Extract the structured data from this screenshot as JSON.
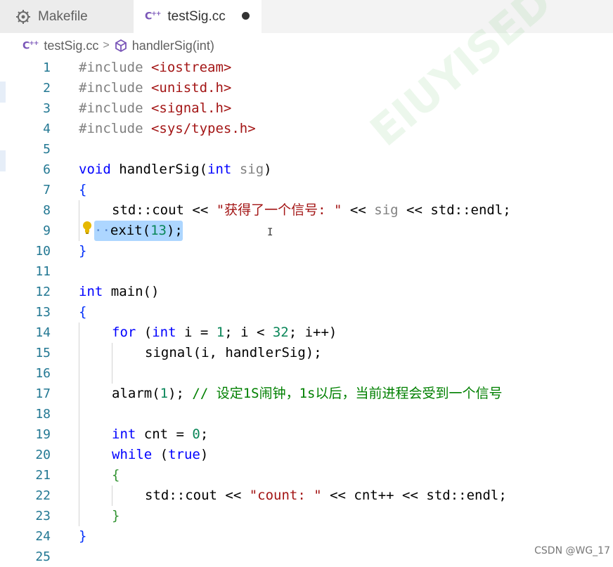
{
  "tabs": [
    {
      "label": "Makefile",
      "icon": "makefile-gear-icon",
      "active": false
    },
    {
      "label": "testSig.cc",
      "icon": "cpp-file-icon",
      "active": true,
      "modified": true
    }
  ],
  "breadcrumb": {
    "file": "testSig.cc",
    "symbol": "handlerSig(int)"
  },
  "line_numbers": [
    "1",
    "2",
    "3",
    "4",
    "5",
    "6",
    "7",
    "8",
    "9",
    "10",
    "11",
    "12",
    "13",
    "14",
    "15",
    "16",
    "17",
    "18",
    "19",
    "20",
    "21",
    "22",
    "23",
    "24",
    "25"
  ],
  "code": {
    "l1": [
      "#include ",
      "<iostream>"
    ],
    "l2": [
      "#include ",
      "<unistd.h>"
    ],
    "l3": [
      "#include ",
      "<signal.h>"
    ],
    "l4": [
      "#include ",
      "<sys/types.h>"
    ],
    "l6": [
      "void",
      " handlerSig(",
      "int",
      " sig",
      ")"
    ],
    "l7": [
      "{"
    ],
    "l8": [
      "std::cout << ",
      "\"获得了一个信号: \"",
      " << ",
      "sig",
      " << std::endl;"
    ],
    "l9": [
      "··",
      "exit(",
      "13",
      ");"
    ],
    "l10": [
      "}"
    ],
    "l12": [
      "int",
      " main()"
    ],
    "l13": [
      "{"
    ],
    "l14": [
      "for",
      " (",
      "int",
      " i = ",
      "1",
      "; i < ",
      "32",
      "; i++)"
    ],
    "l15": [
      "signal(i, handlerSig);"
    ],
    "l17": [
      "alarm(",
      "1",
      "); ",
      "// 设定1S闹钟，1s以后，当前进程会受到一个信号"
    ],
    "l19": [
      "int",
      " cnt = ",
      "0",
      ";"
    ],
    "l20": [
      "while",
      " (",
      "true",
      ")"
    ],
    "l21": [
      "{"
    ],
    "l22": [
      "std::cout << ",
      "\"count: \"",
      " << cnt++ << std::endl;"
    ],
    "l23": [
      "}"
    ],
    "l24": [
      "}"
    ]
  },
  "watermark": "EIUYISED",
  "credit": "CSDN @WG_17",
  "colors": {
    "keyword": "#0000ff",
    "string": "#a31515",
    "number": "#098658",
    "comment": "#008000",
    "line_number": "#237893",
    "selection": "#add6ff"
  }
}
